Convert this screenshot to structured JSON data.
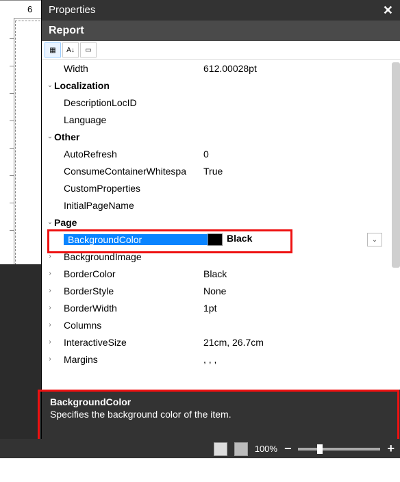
{
  "ruler_label": "6",
  "panel": {
    "title": "Properties"
  },
  "object_name": "Report",
  "rows": [
    {
      "kind": "prop",
      "depth": 1,
      "name": "Width",
      "value": "612.00028pt"
    },
    {
      "kind": "group",
      "depth": 0,
      "name": "Localization",
      "arrow": "v"
    },
    {
      "kind": "prop",
      "depth": 1,
      "name": "DescriptionLocID",
      "value": ""
    },
    {
      "kind": "prop",
      "depth": 1,
      "name": "Language",
      "value": ""
    },
    {
      "kind": "group",
      "depth": 0,
      "name": "Other",
      "arrow": "v"
    },
    {
      "kind": "prop",
      "depth": 1,
      "name": "AutoRefresh",
      "value": "0"
    },
    {
      "kind": "prop",
      "depth": 1,
      "name": "ConsumeContainerWhitespa",
      "value": "True"
    },
    {
      "kind": "prop",
      "depth": 1,
      "name": "CustomProperties",
      "value": ""
    },
    {
      "kind": "prop",
      "depth": 1,
      "name": "InitialPageName",
      "value": ""
    },
    {
      "kind": "group",
      "depth": 0,
      "name": "Page",
      "arrow": "v"
    },
    {
      "kind": "prop-selected",
      "depth": 1,
      "name": "BackgroundColor",
      "value": "Black"
    },
    {
      "kind": "prop-exp",
      "depth": 1,
      "name": "BackgroundImage",
      "value": ""
    },
    {
      "kind": "prop-exp",
      "depth": 1,
      "name": "BorderColor",
      "value": "Black"
    },
    {
      "kind": "prop-exp",
      "depth": 1,
      "name": "BorderStyle",
      "value": "None"
    },
    {
      "kind": "prop-exp",
      "depth": 1,
      "name": "BorderWidth",
      "value": "1pt"
    },
    {
      "kind": "prop-exp",
      "depth": 1,
      "name": "Columns",
      "value": ""
    },
    {
      "kind": "prop-exp",
      "depth": 1,
      "name": "InteractiveSize",
      "value": "21cm, 26.7cm"
    },
    {
      "kind": "prop-exp",
      "depth": 1,
      "name": "Margins",
      "value": ", , ,"
    }
  ],
  "description": {
    "title": "BackgroundColor",
    "text": "Specifies the background color of the item."
  },
  "zoom": {
    "label": "100%"
  }
}
